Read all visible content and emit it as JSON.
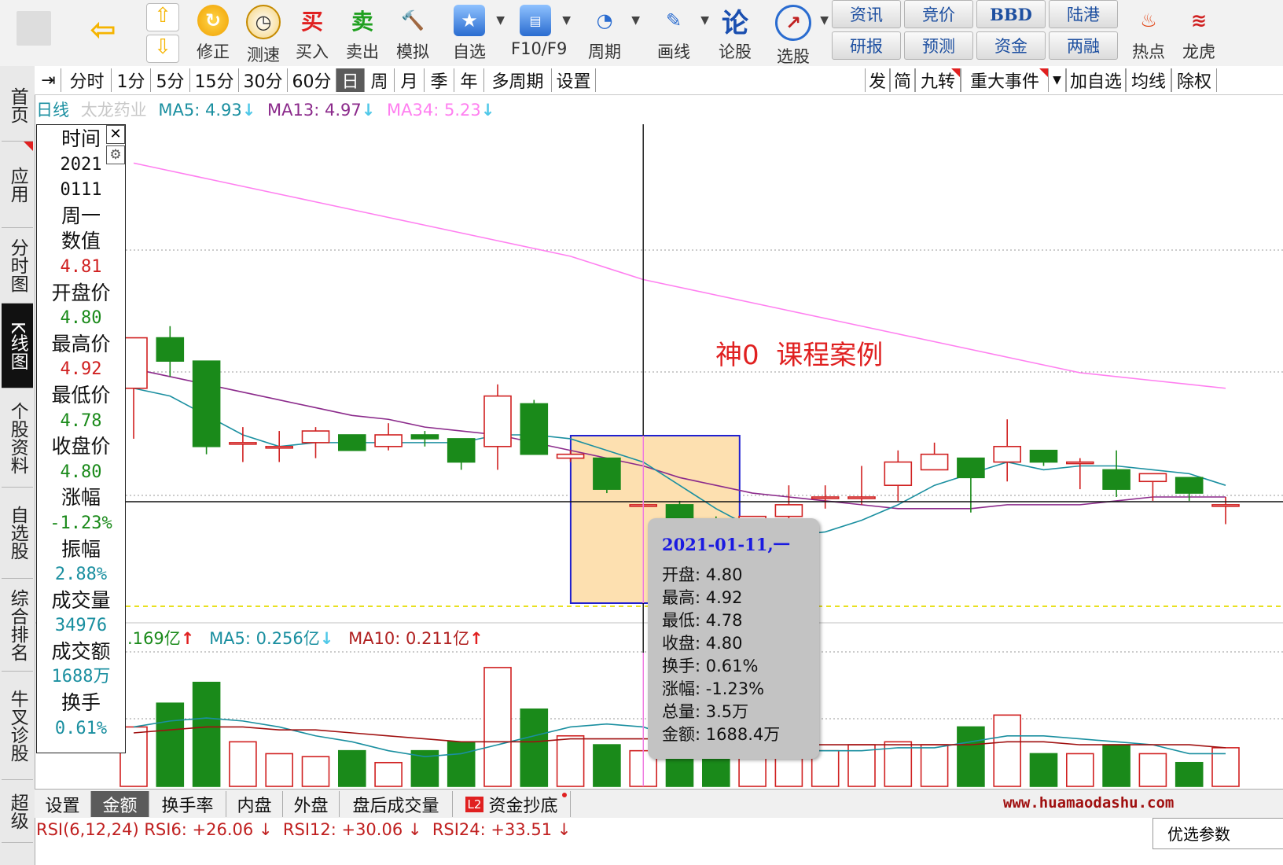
{
  "toolbar": {
    "big_buttons": [
      {
        "label": "",
        "icon": "app-logo-icon"
      },
      {
        "label": "",
        "icon": "back-arrow-icon"
      },
      {
        "label": "修正",
        "icon": "refresh-icon"
      },
      {
        "label": "测速",
        "icon": "clock-icon"
      },
      {
        "label": "买入",
        "icon": "buy-icon",
        "glyph": "买"
      },
      {
        "label": "卖出",
        "icon": "sell-icon",
        "glyph": "卖"
      },
      {
        "label": "模拟",
        "icon": "gavel-icon"
      },
      {
        "label": "自选",
        "icon": "star-folder-icon"
      },
      {
        "label": "F10/F9",
        "icon": "f10-icon"
      },
      {
        "label": "周期",
        "icon": "period-clock-icon"
      },
      {
        "label": "画线",
        "icon": "pen-icon"
      },
      {
        "label": "论股",
        "icon": "discuss-icon",
        "glyph": "论"
      },
      {
        "label": "选股",
        "icon": "stock-picker-icon"
      },
      {
        "label": "热点",
        "icon": "hot-icon"
      },
      {
        "label": "龙虎",
        "icon": "dragon-icon"
      }
    ],
    "info_top": [
      "资讯",
      "竞价",
      "BBD",
      "陆港"
    ],
    "info_bottom": [
      "研报",
      "预测",
      "资金",
      "两融"
    ]
  },
  "nav": {
    "items": [
      "首页",
      "应用",
      "分时图",
      "K线图",
      "个股资料",
      "自选股",
      "综合排名",
      "牛叉诊股",
      "超级"
    ]
  },
  "period_bar": {
    "items": [
      "分时",
      "1分",
      "5分",
      "15分",
      "30分",
      "60分",
      "日",
      "周",
      "月",
      "季",
      "年",
      "多周期",
      "设置"
    ],
    "selected": "日",
    "right_items": [
      "发",
      "简",
      "九转",
      "重大事件",
      "加自选",
      "均线",
      "除权"
    ]
  },
  "legend": {
    "period": "日线",
    "stock_name": "太龙药业",
    "ma5": "MA5: 4.93",
    "ma13": "MA13: 4.97",
    "ma34": "MA34: 5.23",
    "arrow_down": "↓"
  },
  "annotation": "神0  课程案例",
  "data_panel": {
    "rows": [
      {
        "text": "时间",
        "kind": "label"
      },
      {
        "text": "2021",
        "kind": "value",
        "color": "#111111"
      },
      {
        "text": "0111",
        "kind": "value",
        "color": "#111111"
      },
      {
        "text": "周一",
        "kind": "label"
      },
      {
        "text": "数值",
        "kind": "label"
      },
      {
        "text": "4.81",
        "kind": "value",
        "color": "#d02020"
      },
      {
        "text": "开盘价",
        "kind": "label"
      },
      {
        "text": "4.80",
        "kind": "value",
        "color": "#1a8a1a"
      },
      {
        "text": "最高价",
        "kind": "label"
      },
      {
        "text": "4.92",
        "kind": "value",
        "color": "#d02020"
      },
      {
        "text": "最低价",
        "kind": "label"
      },
      {
        "text": "4.78",
        "kind": "value",
        "color": "#1a8a1a"
      },
      {
        "text": "收盘价",
        "kind": "label"
      },
      {
        "text": "4.80",
        "kind": "value",
        "color": "#1a8a1a"
      },
      {
        "text": "涨幅",
        "kind": "label"
      },
      {
        "text": "-1.23%",
        "kind": "value",
        "color": "#1a8a1a"
      },
      {
        "text": "振幅",
        "kind": "label"
      },
      {
        "text": "2.88%",
        "kind": "value",
        "color": "#1a8fa0"
      },
      {
        "text": "成交量",
        "kind": "label"
      },
      {
        "text": "34976",
        "kind": "value",
        "color": "#1a8fa0"
      },
      {
        "text": "成交额",
        "kind": "label"
      },
      {
        "text": "1688万",
        "kind": "value",
        "color": "#1a8fa0"
      },
      {
        "text": "换手",
        "kind": "label"
      },
      {
        "text": "0.61%",
        "kind": "value",
        "color": "#1a8fa0"
      }
    ]
  },
  "tooltip": {
    "title": "2021-01-11,一",
    "lines": [
      "开盘: 4.80",
      "最高: 4.92",
      "最低: 4.78",
      "收盘: 4.80",
      "换手: 0.61%",
      "涨幅: -1.23%",
      "总量: 3.5万",
      "金额: 1688.4万"
    ]
  },
  "volume_legend": {
    "value": ".169亿",
    "ma5": "MA5: 0.256亿",
    "ma10": "MA10: 0.211亿",
    "arrow_up": "↑",
    "arrow_down": "↓"
  },
  "bottom_tabs": {
    "items": [
      "设置",
      "金额",
      "换手率",
      "内盘",
      "外盘",
      "盘后成交量",
      "资金抄底"
    ],
    "selected": "金额",
    "badge": "L2"
  },
  "watermark": "www.huamaodashu.com",
  "rsi_line": "RSI(6,12,24) RSI6: +26.06 ↓  RSI12: +30.06 ↓  RSI24: +33.51 ↓",
  "corner_label": "优选参数",
  "colors": {
    "up": "#d02020",
    "down": "#1a8a1a",
    "ma5": "#1a8fa0",
    "ma13": "#8b2a8b",
    "ma34": "#ff7ff0",
    "highlight": "#fde0b0",
    "highlight_border": "#2020d0"
  },
  "chart_data": {
    "type": "candlestick",
    "title": "太龙药业 日线",
    "price_range": [
      4.35,
      5.63
    ],
    "candles": [
      {
        "o": 4.95,
        "h": 5.02,
        "l": 4.82,
        "c": 5.08
      },
      {
        "o": 5.08,
        "h": 5.11,
        "l": 4.98,
        "c": 5.02
      },
      {
        "o": 5.02,
        "h": 5.02,
        "l": 4.78,
        "c": 4.8
      },
      {
        "o": 4.81,
        "h": 4.85,
        "l": 4.76,
        "c": 4.81
      },
      {
        "o": 4.8,
        "h": 4.84,
        "l": 4.76,
        "c": 4.8
      },
      {
        "o": 4.81,
        "h": 4.85,
        "l": 4.77,
        "c": 4.84
      },
      {
        "o": 4.83,
        "h": 4.83,
        "l": 4.79,
        "c": 4.79
      },
      {
        "o": 4.8,
        "h": 4.86,
        "l": 4.79,
        "c": 4.83
      },
      {
        "o": 4.83,
        "h": 4.84,
        "l": 4.8,
        "c": 4.82
      },
      {
        "o": 4.82,
        "h": 4.82,
        "l": 4.74,
        "c": 4.76
      },
      {
        "o": 4.8,
        "h": 4.96,
        "l": 4.74,
        "c": 4.93
      },
      {
        "o": 4.91,
        "h": 4.92,
        "l": 4.78,
        "c": 4.78
      },
      {
        "o": 4.77,
        "h": 4.79,
        "l": 4.76,
        "c": 4.78
      },
      {
        "o": 4.77,
        "h": 4.77,
        "l": 4.68,
        "c": 4.69
      },
      {
        "o": 4.65,
        "h": 4.65,
        "l": 4.65,
        "c": 4.65
      },
      {
        "o": 4.65,
        "h": 4.66,
        "l": 4.49,
        "c": 4.5
      },
      {
        "o": 4.61,
        "h": 4.62,
        "l": 4.48,
        "c": 4.55
      },
      {
        "o": 4.61,
        "h": 4.62,
        "l": 4.56,
        "c": 4.62
      },
      {
        "o": 4.62,
        "h": 4.7,
        "l": 4.6,
        "c": 4.65
      },
      {
        "o": 4.67,
        "h": 4.7,
        "l": 4.64,
        "c": 4.67
      },
      {
        "o": 4.67,
        "h": 4.75,
        "l": 4.65,
        "c": 4.67
      },
      {
        "o": 4.7,
        "h": 4.79,
        "l": 4.66,
        "c": 4.76
      },
      {
        "o": 4.74,
        "h": 4.81,
        "l": 4.74,
        "c": 4.78
      },
      {
        "o": 4.77,
        "h": 4.77,
        "l": 4.63,
        "c": 4.72
      },
      {
        "o": 4.76,
        "h": 4.87,
        "l": 4.71,
        "c": 4.8
      },
      {
        "o": 4.79,
        "h": 4.79,
        "l": 4.75,
        "c": 4.76
      },
      {
        "o": 4.76,
        "h": 4.77,
        "l": 4.69,
        "c": 4.76
      },
      {
        "o": 4.74,
        "h": 4.79,
        "l": 4.67,
        "c": 4.69
      },
      {
        "o": 4.71,
        "h": 4.72,
        "l": 4.66,
        "c": 4.73
      },
      {
        "o": 4.72,
        "h": 4.72,
        "l": 4.66,
        "c": 4.68
      },
      {
        "o": 4.65,
        "h": 4.67,
        "l": 4.6,
        "c": 4.65
      }
    ],
    "ma5": [
      4.95,
      4.93,
      4.88,
      4.83,
      4.8,
      4.81,
      4.81,
      4.81,
      4.81,
      4.81,
      4.83,
      4.83,
      4.82,
      4.79,
      4.76,
      4.7,
      4.64,
      4.59,
      4.57,
      4.58,
      4.61,
      4.65,
      4.7,
      4.73,
      4.76,
      4.74,
      4.75,
      4.75,
      4.74,
      4.73,
      4.7
    ],
    "ma13": [
      5.0,
      4.98,
      4.96,
      4.94,
      4.92,
      4.9,
      4.88,
      4.87,
      4.85,
      4.84,
      4.83,
      4.81,
      4.79,
      4.77,
      4.75,
      4.72,
      4.7,
      4.68,
      4.67,
      4.66,
      4.65,
      4.64,
      4.64,
      4.64,
      4.65,
      4.65,
      4.65,
      4.66,
      4.67,
      4.67,
      4.67
    ],
    "ma34": [
      5.53,
      5.51,
      5.49,
      5.47,
      5.45,
      5.43,
      5.41,
      5.39,
      5.37,
      5.35,
      5.33,
      5.31,
      5.29,
      5.26,
      5.23,
      5.21,
      5.19,
      5.17,
      5.15,
      5.13,
      5.11,
      5.09,
      5.07,
      5.05,
      5.03,
      5.01,
      4.99,
      4.98,
      4.97,
      4.96,
      4.95
    ],
    "volume_range": [
      0,
      0.45
    ],
    "volume": [
      0.2,
      0.28,
      0.35,
      0.15,
      0.11,
      0.1,
      0.12,
      0.08,
      0.12,
      0.15,
      0.4,
      0.26,
      0.17,
      0.14,
      0.12,
      0.11,
      0.11,
      0.12,
      0.12,
      0.12,
      0.14,
      0.15,
      0.14,
      0.2,
      0.24,
      0.11,
      0.11,
      0.14,
      0.11,
      0.08,
      0.13
    ],
    "volume_ma5": [
      0.2,
      0.22,
      0.23,
      0.22,
      0.2,
      0.17,
      0.15,
      0.12,
      0.1,
      0.11,
      0.14,
      0.17,
      0.2,
      0.21,
      0.2,
      0.16,
      0.13,
      0.12,
      0.12,
      0.12,
      0.12,
      0.13,
      0.13,
      0.15,
      0.17,
      0.17,
      0.16,
      0.15,
      0.14,
      0.11,
      0.11
    ],
    "volume_ma10": [
      0.18,
      0.19,
      0.2,
      0.2,
      0.19,
      0.19,
      0.18,
      0.17,
      0.16,
      0.15,
      0.15,
      0.15,
      0.16,
      0.16,
      0.16,
      0.16,
      0.15,
      0.15,
      0.14,
      0.14,
      0.14,
      0.14,
      0.14,
      0.14,
      0.15,
      0.15,
      0.14,
      0.14,
      0.14,
      0.14,
      0.13
    ],
    "selected_index": 14,
    "highlight_range": [
      13,
      16
    ]
  }
}
